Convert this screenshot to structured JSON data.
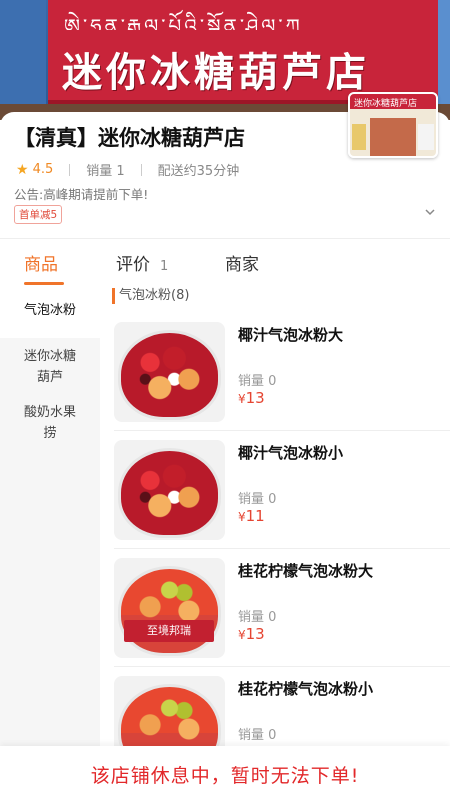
{
  "banner": {
    "sign_text": "迷你冰糖葫芦店",
    "tibetan_text": "ཨེ་ཧྲན་རྒྱལ་པོའི་སྒྲོན་ཤེལ་ཀ",
    "thumb_text": "迷你冰糖葫芦店"
  },
  "shop": {
    "name": "【清真】迷你冰糖葫芦店",
    "rating": "4.5",
    "sales": "销量 1",
    "delivery": "配送约35分钟",
    "notice": "公告:高峰期请提前下单!",
    "badge": "首单减5"
  },
  "tabs": [
    {
      "label": "商品"
    },
    {
      "label": "评价",
      "count": "1"
    },
    {
      "label": "商家"
    }
  ],
  "sidebar": {
    "items": [
      {
        "label": "气泡冰粉"
      },
      {
        "label": "迷你冰糖葫芦"
      },
      {
        "label": "酸奶水果捞"
      }
    ]
  },
  "section": {
    "title": "气泡冰粉(8)"
  },
  "products": [
    {
      "name": "椰汁气泡冰粉大",
      "sales": "销量 0",
      "price": "13"
    },
    {
      "name": "椰汁气泡冰粉小",
      "sales": "销量 0",
      "price": "11"
    },
    {
      "name": "桂花柠檬气泡冰粉大",
      "sales": "销量 0",
      "price": "13",
      "cup_label": "至境邦瑞"
    },
    {
      "name": "桂花柠檬气泡冰粉小",
      "sales": "销量 0"
    }
  ],
  "currency": "¥",
  "bottom_message": "该店铺休息中，暂时无法下单!",
  "colors": {
    "accent": "#f0742a",
    "price": "#e54532",
    "closed_message": "#e2282a",
    "star": "#f5a623"
  }
}
